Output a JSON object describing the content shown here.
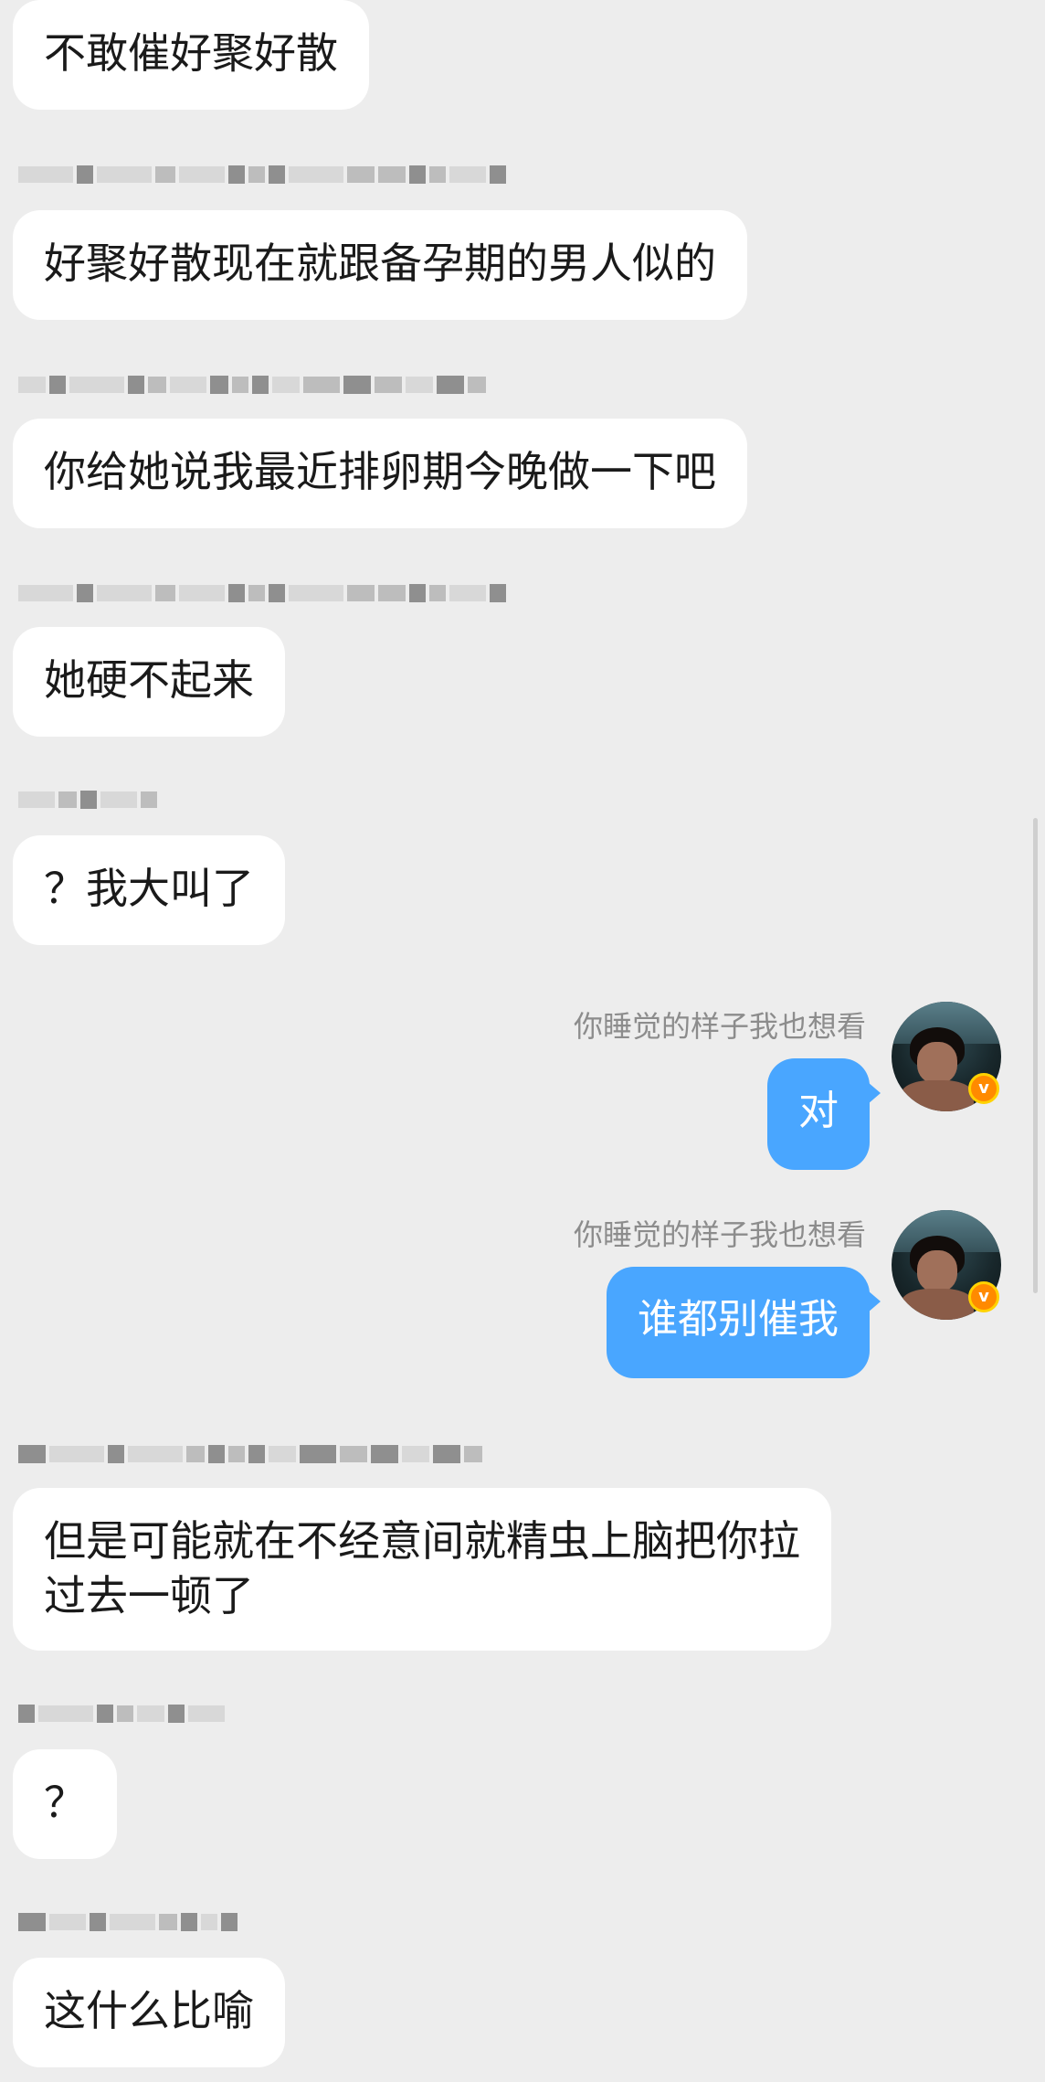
{
  "messages": [
    {
      "side": "incoming",
      "text": "不敢催好聚好散"
    },
    {
      "side": "incoming",
      "text": "好聚好散现在就跟备孕期的男人似的"
    },
    {
      "side": "incoming",
      "text": "你给她说我最近排卵期今晚做一下吧"
    },
    {
      "side": "incoming",
      "text": "她硬不起来"
    },
    {
      "side": "incoming",
      "text": "？我大叫了"
    },
    {
      "side": "outgoing",
      "sender": "你睡觉的样子我也想看",
      "text": "对"
    },
    {
      "side": "outgoing",
      "sender": "你睡觉的样子我也想看",
      "text": "谁都别催我"
    },
    {
      "side": "incoming",
      "lines": [
        "但是可能就在不经意间就精虫上脑把你拉",
        "过去一顿了"
      ]
    },
    {
      "side": "incoming",
      "text": "？"
    },
    {
      "side": "incoming",
      "text": "这什么比喻"
    }
  ],
  "icons": {
    "avatar_badge": "v-verified-badge-icon",
    "avatar_badge_letter": "v"
  },
  "colors": {
    "background": "#ededed",
    "incoming_bubble": "#ffffff",
    "outgoing_bubble": "#49a6ff",
    "sender_name": "#8c8c8c",
    "badge": "#ff8a00"
  }
}
